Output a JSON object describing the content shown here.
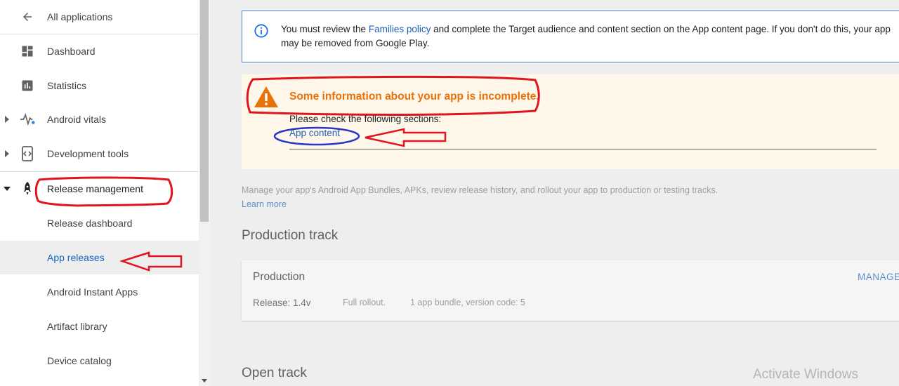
{
  "sidebar": {
    "back": {
      "label": "All applications",
      "icon": "arrow-back-icon"
    },
    "items": [
      {
        "label": "Dashboard",
        "icon": "dashboard-icon"
      },
      {
        "label": "Statistics",
        "icon": "statistics-icon"
      },
      {
        "label": "Android vitals",
        "icon": "vitals-icon",
        "expandable": true
      },
      {
        "label": "Development tools",
        "icon": "dev-tools-icon",
        "expandable": true
      },
      {
        "label": "Release management",
        "icon": "rocket-icon",
        "expanded": true
      }
    ],
    "sub_items": [
      {
        "label": "Release dashboard"
      },
      {
        "label": "App releases",
        "selected": true
      },
      {
        "label": "Android Instant Apps"
      },
      {
        "label": "Artifact library"
      },
      {
        "label": "Device catalog"
      }
    ]
  },
  "info_banner": {
    "icon": "info-icon",
    "text_before": "You must review the ",
    "link": "Families policy",
    "text_after": " and complete the Target audience and content section on the App content page. If you don't do this, your app may be removed from Google Play."
  },
  "warning": {
    "icon": "warning-icon",
    "title": "Some information about your app is incomplete.",
    "subtitle": "Please check the following sections:",
    "link": "App content"
  },
  "description": {
    "text": "Manage your app's Android App Bundles, APKs, review release history, and rollout your app to production or testing tracks.",
    "learn_more": "Learn more"
  },
  "production_track": {
    "heading": "Production track",
    "name": "Production",
    "manage": "MANAGE",
    "release": "Release: 1.4v",
    "rollout": "Full rollout.",
    "bundle": "1 app bundle, version code: 5"
  },
  "open_track": {
    "heading": "Open track"
  },
  "watermark": "Activate Windows",
  "colors": {
    "accent_blue": "#1a5fb4",
    "warning_orange": "#e8710a",
    "annotation_red": "#e0141e",
    "annotation_blue": "#2b35c8"
  }
}
